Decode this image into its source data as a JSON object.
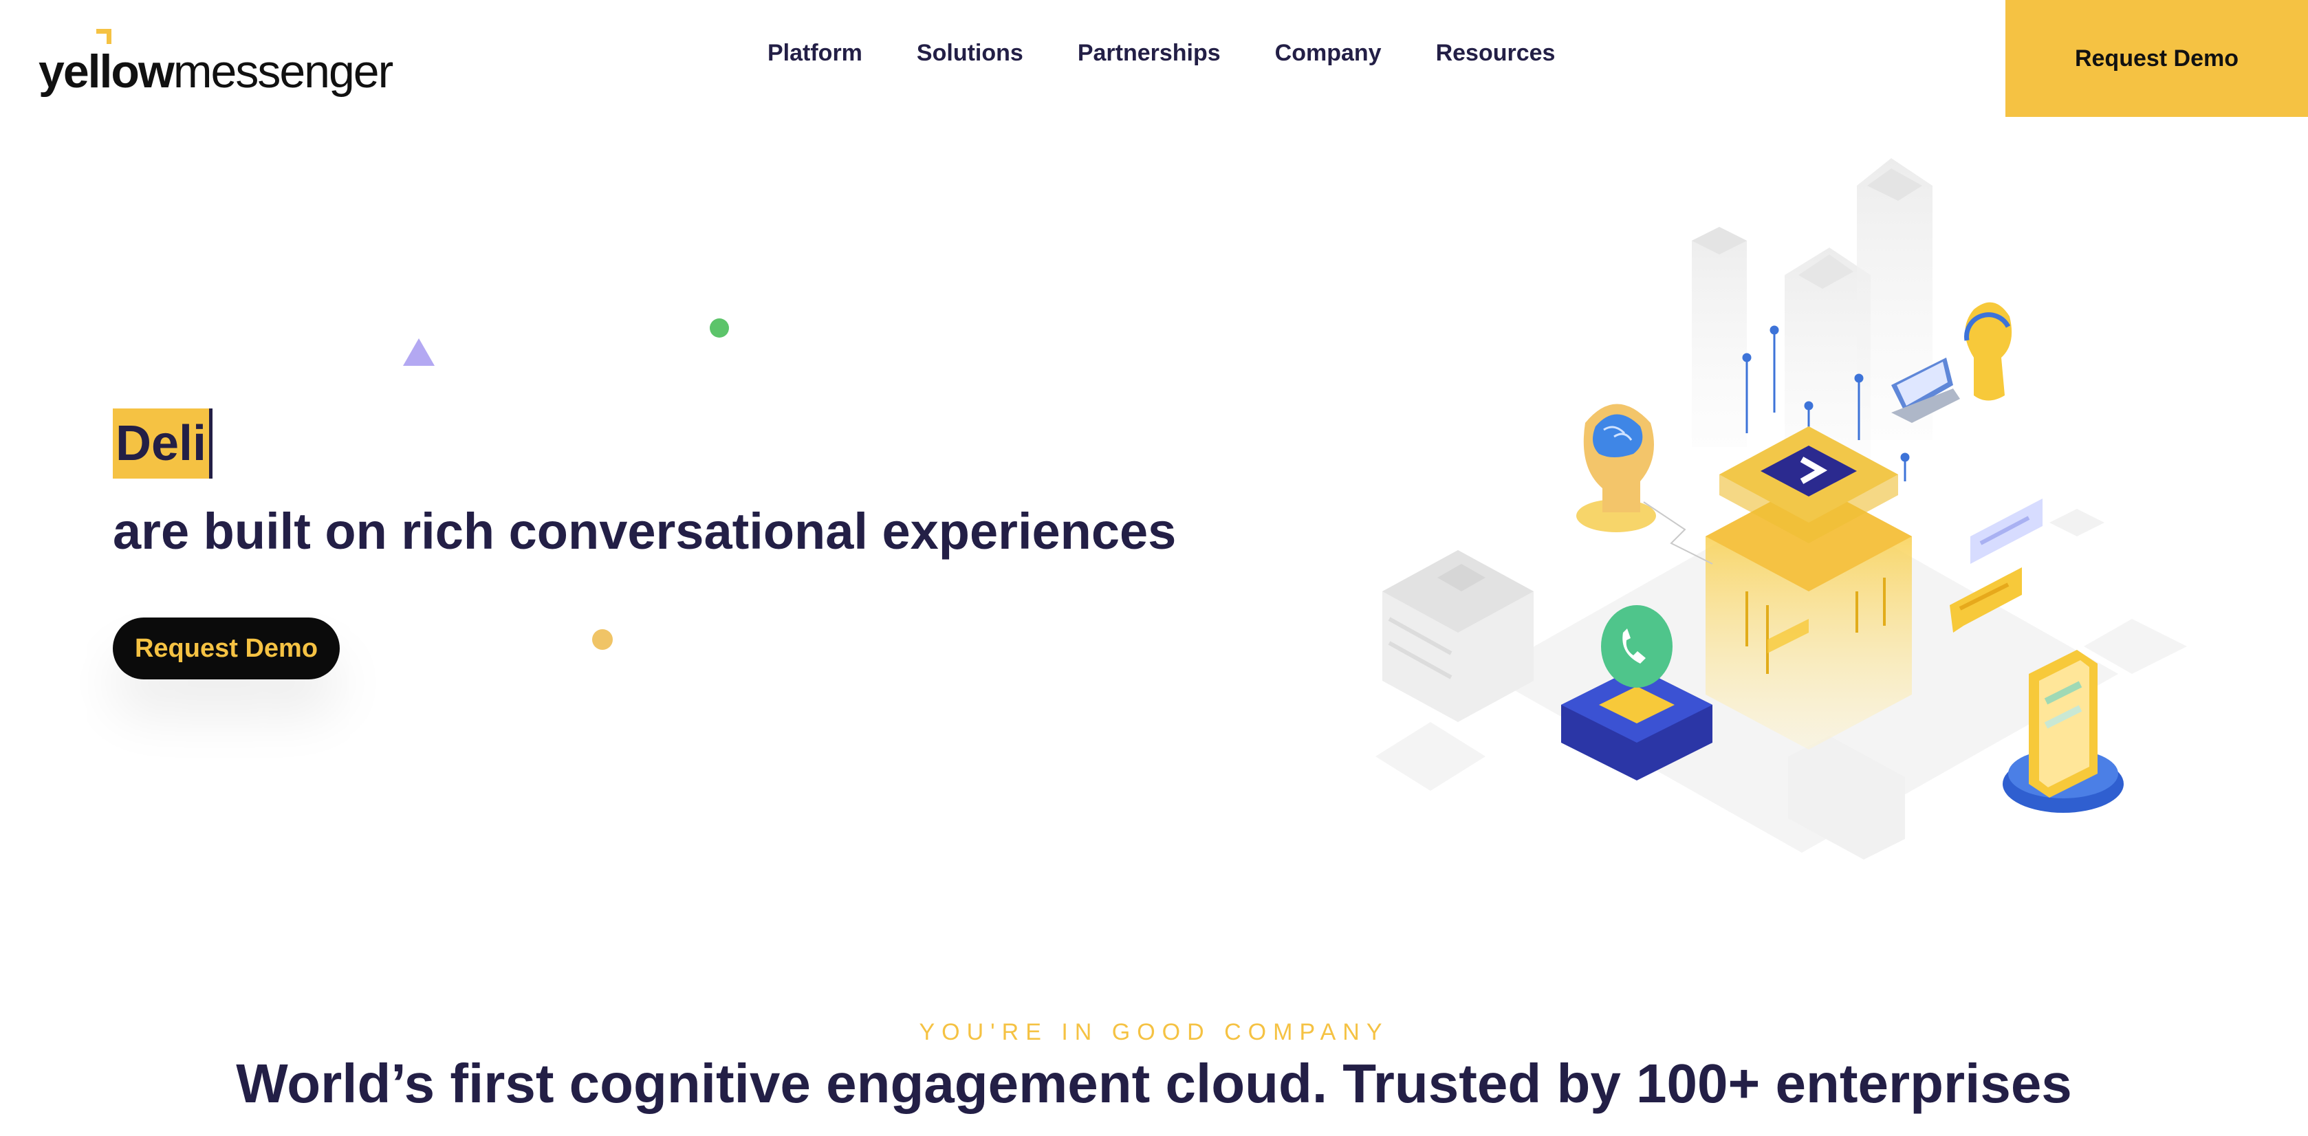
{
  "header": {
    "logo": {
      "part1": "yellow",
      "part2": "messenger"
    },
    "nav": [
      "Platform",
      "Solutions",
      "Partnerships",
      "Company",
      "Resources"
    ],
    "cta_label": "Request Demo"
  },
  "hero": {
    "typed_text": "Deli",
    "subtitle": "are built on rich conversational experiences",
    "cta_label": "Request Demo"
  },
  "trust": {
    "eyebrow": "YOU'RE IN GOOD COMPANY",
    "title": "World’s first cognitive engagement cloud. Trusted by 100+ enterprises"
  },
  "colors": {
    "accent": "#f5c243",
    "text_dark": "#231f46",
    "button_dark": "#0b0b0b",
    "deco_purple": "#b3a8f2",
    "deco_green": "#5cc46a",
    "deco_yellow": "#f0c466"
  }
}
